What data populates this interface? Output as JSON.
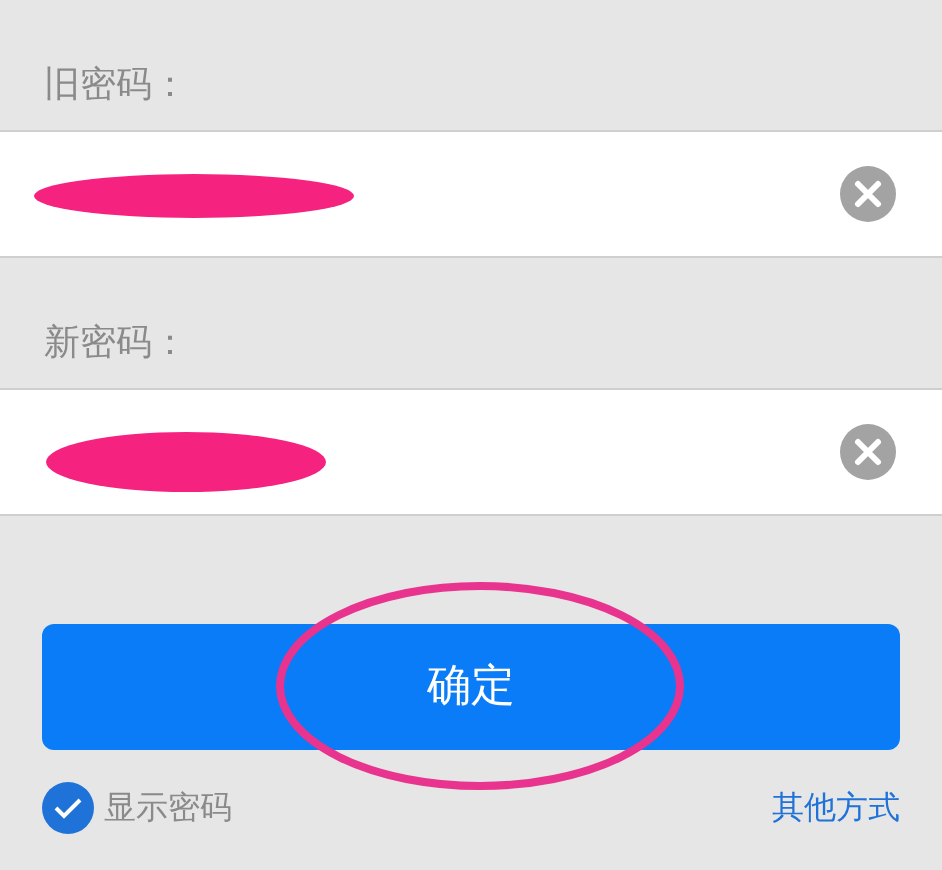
{
  "fields": [
    {
      "label": "旧密码：",
      "redacted": true
    },
    {
      "label": "新密码：",
      "redacted": true
    }
  ],
  "submit": {
    "label": "确定",
    "circled": true
  },
  "show_password": {
    "label": "显示密码",
    "checked": true
  },
  "other_link": "其他方式"
}
